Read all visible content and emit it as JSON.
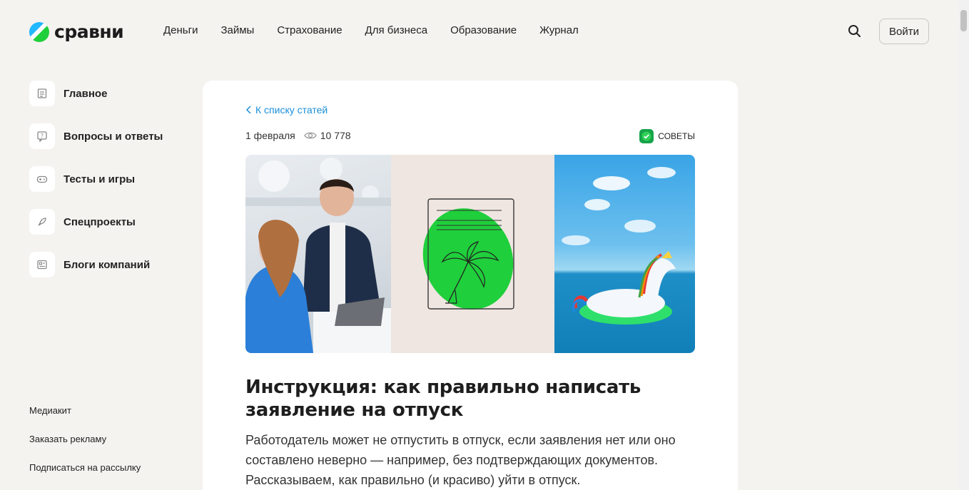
{
  "header": {
    "logo_text": "сравни",
    "nav": [
      "Деньги",
      "Займы",
      "Страхование",
      "Для бизнеса",
      "Образование",
      "Журнал"
    ],
    "login_label": "Войти",
    "search_icon": "search-icon"
  },
  "sidebar": {
    "items": [
      {
        "label": "Главное",
        "icon": "document-icon"
      },
      {
        "label": "Вопросы и ответы",
        "icon": "question-icon"
      },
      {
        "label": "Тесты и игры",
        "icon": "gamepad-icon"
      },
      {
        "label": "Спецпроекты",
        "icon": "rocket-icon"
      },
      {
        "label": "Блоги компаний",
        "icon": "blog-icon"
      }
    ],
    "footer_links": [
      "Медиакит",
      "Заказать рекламу",
      "Подписаться на рассылку"
    ]
  },
  "article": {
    "back_link": "К списку статей",
    "date": "1 февраля",
    "views": "10 778",
    "category": "СОВЕТЫ",
    "title": "Инструкция: как правильно написать заявление на отпуск",
    "lead": "Работодатель может не отпустить в отпуск, если заявления нет или оно составлено неверно — например, без подтверждающих документов. Рассказываем, как правильно (и красиво) уйти в отпуск."
  },
  "colors": {
    "accent_link": "#1b8fd9",
    "brand_green": "#1fcf3b",
    "brand_blue": "#23b8ff",
    "background": "#f4f3f0"
  }
}
